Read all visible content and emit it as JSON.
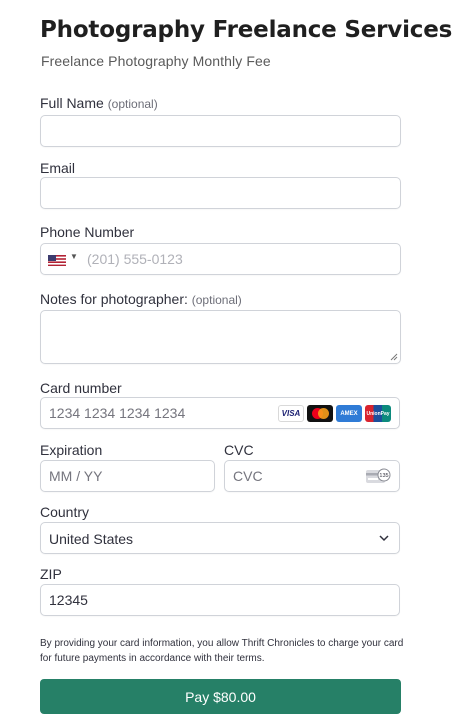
{
  "header": {
    "title": "Photography Freelance Services",
    "subtitle": "Freelance Photography Monthly Fee"
  },
  "form": {
    "full_name": {
      "label": "Full Name",
      "optional": "(optional)",
      "value": ""
    },
    "email": {
      "label": "Email",
      "value": ""
    },
    "phone": {
      "label": "Phone Number",
      "country_flag": "us-flag-icon",
      "placeholder": "(201) 555-0123",
      "value": ""
    },
    "notes": {
      "label": "Notes for photographer:",
      "optional": "(optional)",
      "value": ""
    },
    "card_number": {
      "label": "Card number",
      "placeholder": "1234 1234 1234 1234",
      "brands": [
        "VISA",
        "Mastercard",
        "AMEX",
        "UnionPay"
      ]
    },
    "expiration": {
      "label": "Expiration",
      "placeholder": "MM / YY"
    },
    "cvc": {
      "label": "CVC",
      "placeholder": "CVC",
      "icon_text": "135"
    },
    "country": {
      "label": "Country",
      "selected": "United States"
    },
    "zip": {
      "label": "ZIP",
      "value": "12345"
    }
  },
  "terms": "By providing your card information, you allow Thrift Chronicles to charge your card for future payments in accordance with their terms.",
  "pay_button": {
    "label": "Pay $80.00",
    "color": "#268067"
  }
}
